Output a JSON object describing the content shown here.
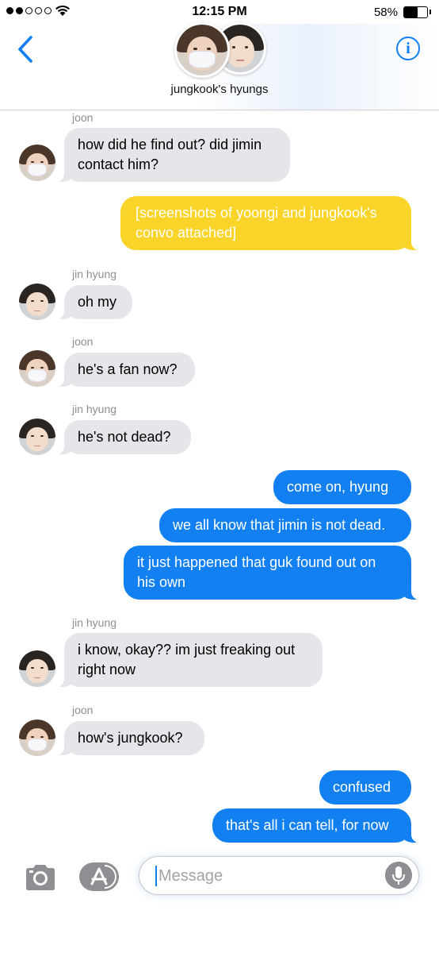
{
  "status_bar": {
    "time": "12:15 PM",
    "battery": "58%",
    "battery_level": 0.58,
    "signal_bars": 2,
    "signal_total": 5
  },
  "header": {
    "group_name": "jungkook's hyungs",
    "info_label": "i",
    "members": [
      "joon-avatar",
      "jin-avatar"
    ]
  },
  "colors": {
    "accent": "#1380f2",
    "incoming_bubble": "#e5e5ea",
    "outgoing_bubble": "#1380f2",
    "attachment_bubble": "#fbd42a",
    "meta_text": "#8e8e93"
  },
  "messages": {
    "m1": {
      "sender": "joon",
      "text": "how did he find out? did jimin contact him?"
    },
    "m2": {
      "text": "[screenshots of yoongi and jungkook's convo attached]"
    },
    "m3": {
      "sender": "jin hyung",
      "text": "oh my"
    },
    "m4": {
      "sender": "joon",
      "text": "he's a fan now?"
    },
    "m5": {
      "sender": "jin hyung",
      "text": "he's not dead?"
    },
    "m6": {
      "text": "come on, hyung"
    },
    "m7": {
      "text": "we all know that jimin is not dead."
    },
    "m8": {
      "text": "it just happened that guk found out on his own"
    },
    "m9": {
      "sender": "jin hyung",
      "text": "i know, okay?? im just freaking out right now"
    },
    "m10": {
      "sender": "joon",
      "text": "how's jungkook?"
    },
    "m11": {
      "text": "confused"
    },
    "m12": {
      "text": "that's all i can tell, for now"
    }
  },
  "input": {
    "placeholder": "Message",
    "value": ""
  },
  "icons": [
    "back-chevron-icon",
    "info-icon",
    "camera-icon",
    "app-store-icon",
    "microphone-icon"
  ]
}
